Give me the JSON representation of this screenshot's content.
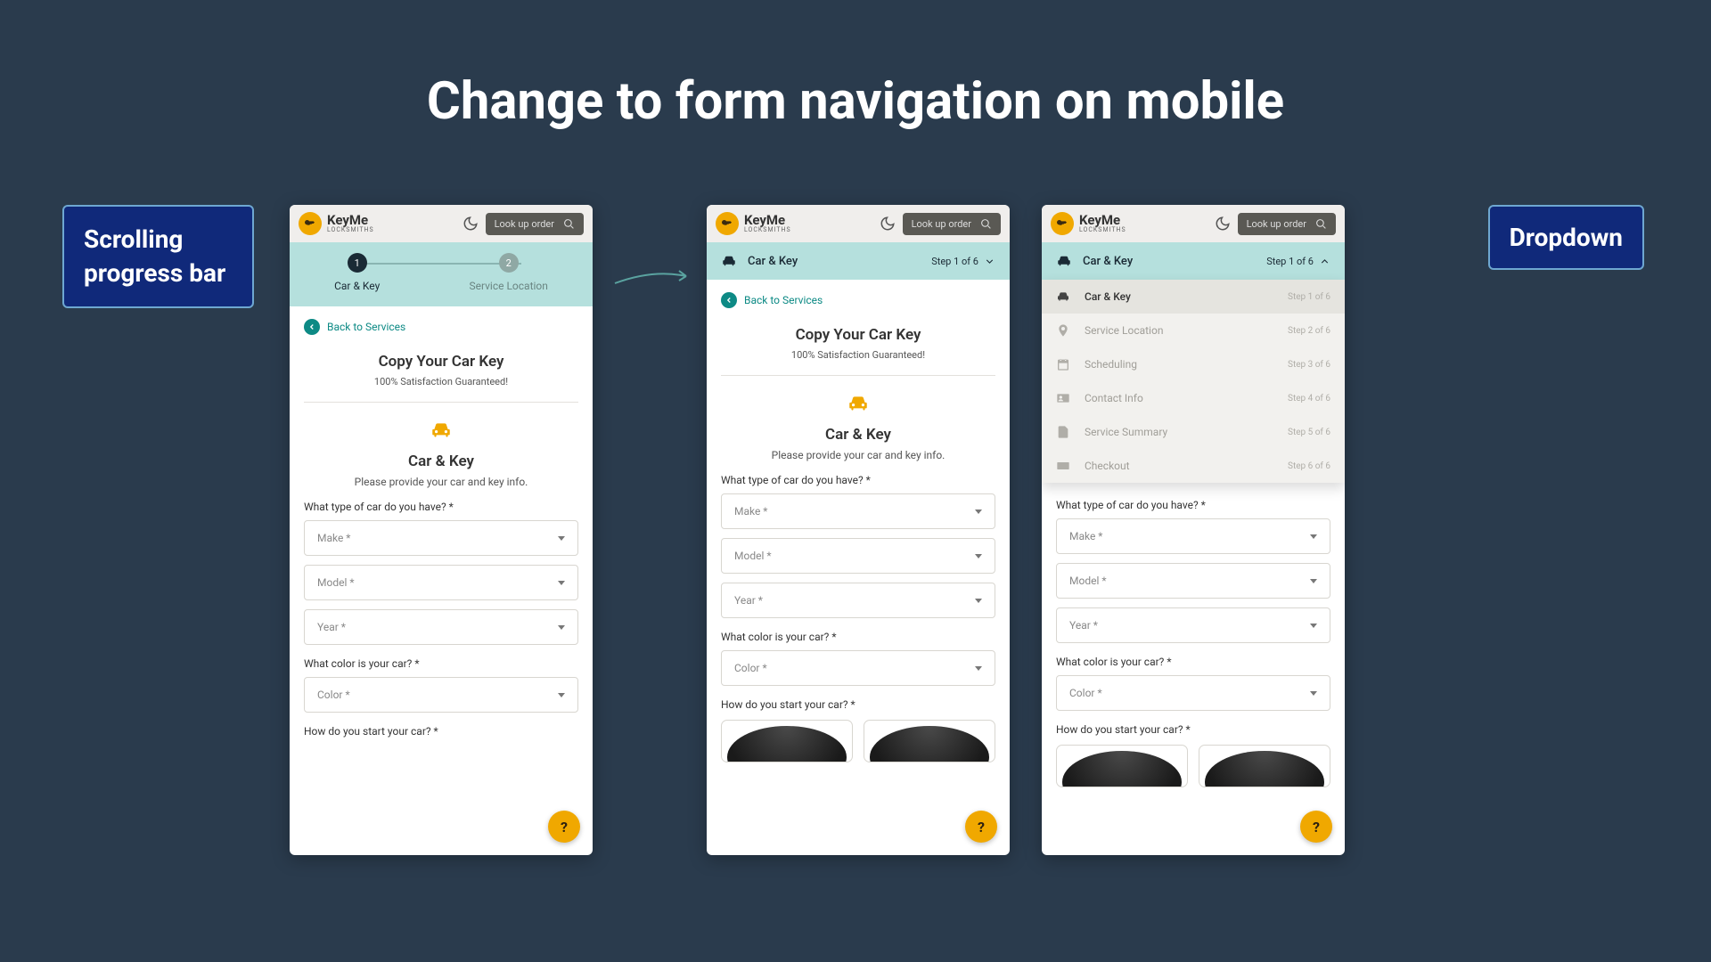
{
  "slide_title": "Change to form navigation on mobile",
  "callouts": {
    "left": "Scrolling progress bar",
    "right": "Dropdown"
  },
  "header": {
    "logo_name": "KeyMe",
    "logo_sub": "LOCKSMITHS",
    "lookup_placeholder": "Look up order"
  },
  "old_progress": {
    "step1": {
      "num": "1",
      "label": "Car & Key"
    },
    "step2": {
      "num": "2",
      "label": "Service Location"
    }
  },
  "new_progress": {
    "title": "Car & Key",
    "step_text": "Step 1 of 6"
  },
  "dropdown_items": [
    {
      "label": "Car & Key",
      "step": "Step 1 of 6",
      "active": true
    },
    {
      "label": "Service Location",
      "step": "Step 2 of 6",
      "active": false
    },
    {
      "label": "Scheduling",
      "step": "Step 3 of 6",
      "active": false
    },
    {
      "label": "Contact Info",
      "step": "Step 4 of 6",
      "active": false
    },
    {
      "label": "Service Summary",
      "step": "Step 5 of 6",
      "active": false
    },
    {
      "label": "Checkout",
      "step": "Step 6 of 6",
      "active": false
    }
  ],
  "body": {
    "back_link": "Back to Services",
    "page_title": "Copy Your Car Key",
    "page_sub": "100% Satisfaction Guaranteed!",
    "section_title": "Car & Key",
    "section_sub": "Please provide your car and key info.",
    "q_car_type": "What type of car do you have? *",
    "sel_make": "Make *",
    "sel_model": "Model *",
    "sel_year": "Year *",
    "q_color": "What color is your car? *",
    "sel_color": "Color *",
    "q_start": "How do you start your car? *",
    "help": "?"
  }
}
